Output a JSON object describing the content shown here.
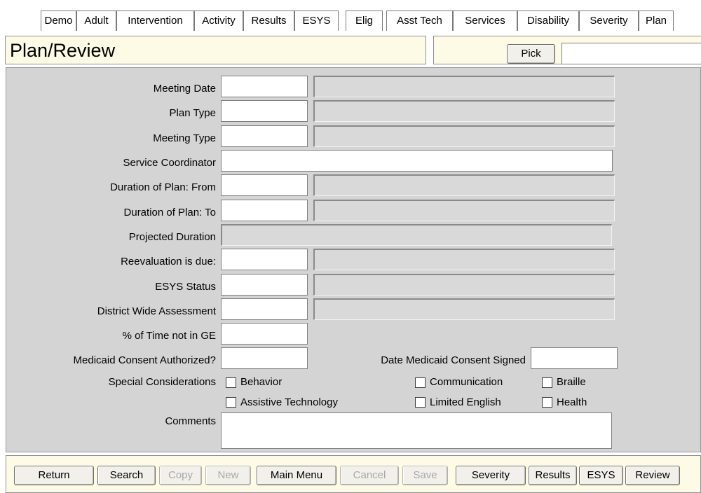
{
  "tabs": [
    "Demo",
    "Adult",
    "Intervention",
    "Activity",
    "Results",
    "ESYS",
    "Elig",
    "Asst Tech",
    "Services",
    "Disability",
    "Severity",
    "Plan"
  ],
  "header": {
    "title": "Plan/Review",
    "pick_label": "Pick",
    "pick_value": ""
  },
  "form": {
    "meeting_date": "Meeting Date",
    "plan_type": "Plan Type",
    "meeting_type": "Meeting Type",
    "service_coordinator": "Service Coordinator",
    "duration_from": "Duration of Plan: From",
    "duration_to": "Duration of Plan: To",
    "projected_duration": "Projected Duration",
    "reevaluation_due": "Reevaluation is due:",
    "esys_status": "ESYS Status",
    "district_assessment": "District Wide Assessment",
    "time_not_in_ge": "% of Time not in GE",
    "medicaid_authorized": "Medicaid Consent Authorized?",
    "medicaid_signed": "Date Medicaid Consent Signed",
    "special_considerations": "Special Considerations",
    "comments": "Comments",
    "checkboxes": {
      "behavior": "Behavior",
      "communication": "Communication",
      "braille": "Braille",
      "assistive_technology": "Assistive Technology",
      "limited_english": "Limited English",
      "health": "Health"
    }
  },
  "footer": {
    "return": "Return",
    "search": "Search",
    "copy": "Copy",
    "new": "New",
    "main_menu": "Main Menu",
    "cancel": "Cancel",
    "save": "Save",
    "severity": "Severity",
    "results": "Results",
    "esys": "ESYS",
    "review": "Review"
  }
}
